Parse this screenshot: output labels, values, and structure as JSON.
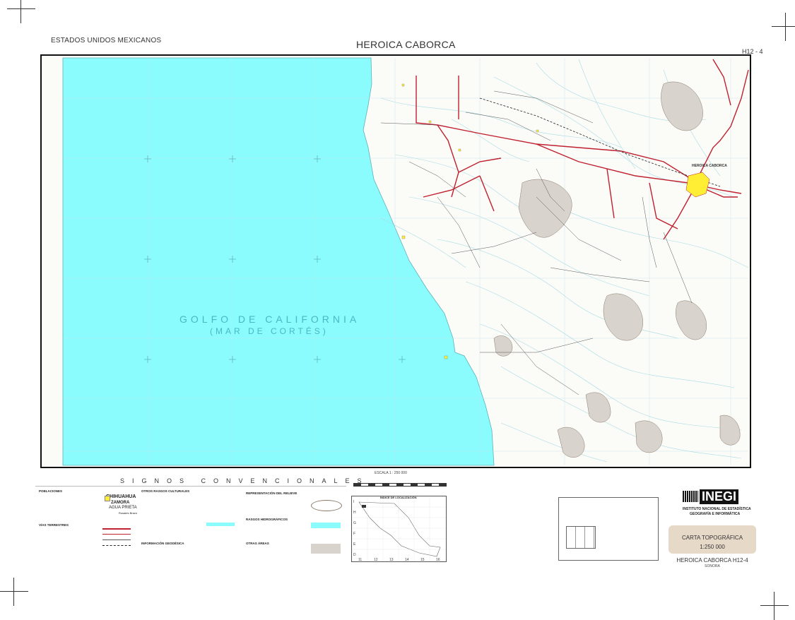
{
  "header": {
    "country": "ESTADOS UNIDOS MEXICANOS",
    "title": "HEROICA CABORCA",
    "sheet_code": "H12 - 4"
  },
  "map": {
    "gulf_name": "GOLFO DE CALIFORNIA",
    "gulf_alt_name": "(MAR DE CORTÉS)",
    "city_name": "HEROICA CABORCA",
    "colors": {
      "sea": "#8bfcfd",
      "land": "#fbfbf8",
      "roads": "#c0202f",
      "city": "#ffee33",
      "contour": "#9ed0d6",
      "relief": "#8a7a6a"
    }
  },
  "legend": {
    "title": "SIGNOS CONVENCIONALES",
    "sections": {
      "poblaciones": "POBLACIONES",
      "otros": "OTROS RASGOS CULTURALES",
      "relieve": "REPRESENTACIÓN DEL RELIEVE",
      "hidro": "RASGOS HIDROGRÁFICOS",
      "vias": "VÍAS TERRESTRES",
      "geodesica": "INFORMACIÓN GEODÉSICA",
      "areas": "OTRAS ÁREAS"
    },
    "sample_city_1": "CHIHUAHUA",
    "sample_city_2": "ZAMORA",
    "sample_city_3": "AGUA PRIETA",
    "sample_city_4": "Rosales Bravo",
    "escala": "ESCALA 1 : 250 000"
  },
  "index": {
    "title": "ÍNDICE DE LOCALIZACIÓN",
    "rows": [
      "I",
      "H",
      "G",
      "F",
      "E",
      "D"
    ],
    "cols": [
      "11",
      "12",
      "13",
      "14",
      "15",
      "16"
    ]
  },
  "inegi": {
    "logo": "INEGI",
    "line1": "INSTITUTO NACIONAL DE ESTADÍSTICA",
    "line2": "GEOGRAFÍA E INFORMÁTICA"
  },
  "carta": {
    "title": "CARTA TOPOGRÁFICA",
    "scale": "1:250 000",
    "sheet_name": "HEROICA CABORCA H12-4",
    "state": "SONORA"
  }
}
